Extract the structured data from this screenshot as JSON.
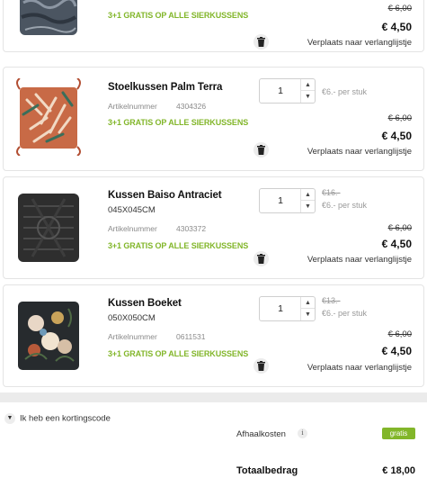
{
  "accent_color": "#82b62a",
  "items": [
    {
      "name": "",
      "dims": "",
      "article_label": "",
      "article_number": "",
      "promo": "3+1 GRATIS OP ALLE SIERKUSSENS",
      "quantity": "",
      "unit_old": "",
      "unit_price": "",
      "old_total": "€ 6,00",
      "new_total": "€ 4,50",
      "wishlist": "Verplaats naar verlanglijstje"
    },
    {
      "name": "Stoelkussen Palm Terra",
      "dims": "",
      "article_label": "Artikelnummer",
      "article_number": "4304326",
      "promo": "3+1 GRATIS OP ALLE SIERKUSSENS",
      "quantity": "1",
      "unit_old": "",
      "unit_price": "€6.- per stuk",
      "old_total": "€ 6,00",
      "new_total": "€ 4,50",
      "wishlist": "Verplaats naar verlanglijstje"
    },
    {
      "name": "Kussen Baiso Antraciet",
      "dims": "045X045CM",
      "article_label": "Artikelnummer",
      "article_number": "4303372",
      "promo": "3+1 GRATIS OP ALLE SIERKUSSENS",
      "quantity": "1",
      "unit_old": "€16.-",
      "unit_price": "€6.- per stuk",
      "old_total": "€ 6,00",
      "new_total": "€ 4,50",
      "wishlist": "Verplaats naar verlanglijstje"
    },
    {
      "name": "Kussen Boeket",
      "dims": "050X050CM",
      "article_label": "Artikelnummer",
      "article_number": "0611531",
      "promo": "3+1 GRATIS OP ALLE SIERKUSSENS",
      "quantity": "1",
      "unit_old": "€13.-",
      "unit_price": "€6.- per stuk",
      "old_total": "€ 6,00",
      "new_total": "€ 4,50",
      "wishlist": "Verplaats naar verlanglijstje"
    }
  ],
  "coupon": {
    "label": "Ik heb een kortingscode"
  },
  "summary": {
    "pickup_label": "Afhaalkosten",
    "info_glyph": "i",
    "pickup_value": "gratis",
    "total_label": "Totaalbedrag",
    "total_value": "€ 18,00"
  },
  "icons": {
    "qty_up": "chevron-up-icon",
    "qty_down": "chevron-down-icon",
    "trash": "trash-icon",
    "coupon_toggle": "chevron-down-icon",
    "info": "info-icon"
  }
}
